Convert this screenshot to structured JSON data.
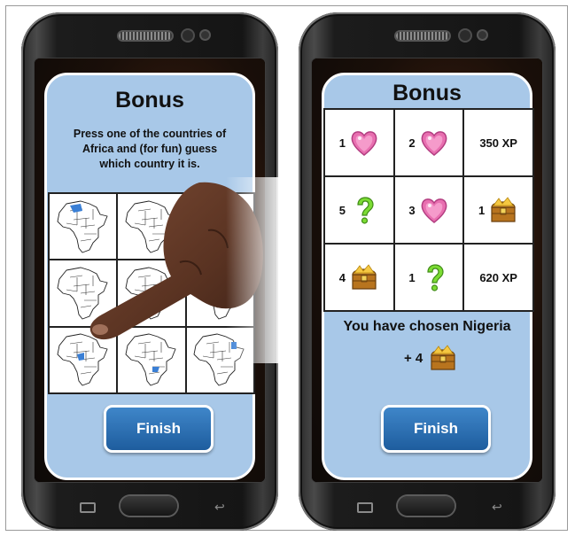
{
  "left_phone": {
    "title": "Bonus",
    "instruction": "Press one of the countries of\nAfrica and (for fun) guess\nwhich country it is.",
    "finish_label": "Finish",
    "highlight_color": "#3a7fd5"
  },
  "right_phone": {
    "title": "Bonus",
    "grid": [
      {
        "count": "1",
        "icon": "heart-icon"
      },
      {
        "count": "2",
        "icon": "heart-icon"
      },
      {
        "count": "350 XP",
        "icon": ""
      },
      {
        "count": "5",
        "icon": "question-mark-icon"
      },
      {
        "count": "3",
        "icon": "heart-icon"
      },
      {
        "count": "1",
        "icon": "treasure-chest-icon"
      },
      {
        "count": "4",
        "icon": "treasure-chest-icon"
      },
      {
        "count": "1",
        "icon": "question-mark-icon"
      },
      {
        "count": "620 XP",
        "icon": ""
      }
    ],
    "chosen_text": "You have chosen Nigeria",
    "gain_text": "+ 4",
    "finish_label": "Finish"
  },
  "colors": {
    "panel": "#a8c8e8",
    "button": "#2a6db0",
    "heart": "#e86fb0",
    "question": "#6fcf2f",
    "chest": "#c98a2a"
  }
}
